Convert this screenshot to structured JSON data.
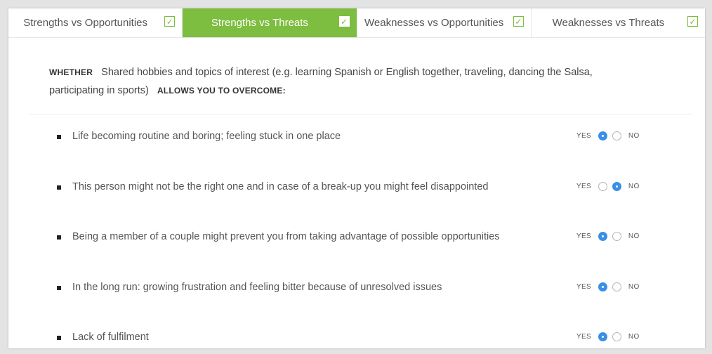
{
  "tabs": [
    {
      "label": "Strengths vs Opportunities",
      "checked": true,
      "active": false
    },
    {
      "label": "Strengths vs Threats",
      "checked": true,
      "active": true
    },
    {
      "label": "Weaknesses vs Opportunities",
      "checked": true,
      "active": false
    },
    {
      "label": "Weaknesses vs Threats",
      "checked": true,
      "active": false
    }
  ],
  "check_glyph": "✓",
  "question": {
    "prefix": "WHETHER",
    "strength": "Shared hobbies and topics of interest (e.g. learning Spanish or English together, traveling, dancing the Salsa, participating in sports)",
    "suffix": "ALLOWS YOU TO OVERCOME:"
  },
  "labels": {
    "yes": "YES",
    "no": "NO"
  },
  "items": [
    {
      "text": "Life becoming routine and boring; feeling stuck in one place",
      "answer": "yes"
    },
    {
      "text": "This person might not be the right one and in case of a break-up you might feel disappointed",
      "answer": "no"
    },
    {
      "text": "Being a member of a couple might prevent you from taking advantage of possible opportunities",
      "answer": "yes"
    },
    {
      "text": "In the long run: growing frustration and feeling bitter because of unresolved issues",
      "answer": "yes"
    },
    {
      "text": "Lack of fulfilment",
      "answer": "yes"
    }
  ],
  "colors": {
    "accent": "#7dbd3f",
    "radio_selected": "#3a8fe6"
  }
}
